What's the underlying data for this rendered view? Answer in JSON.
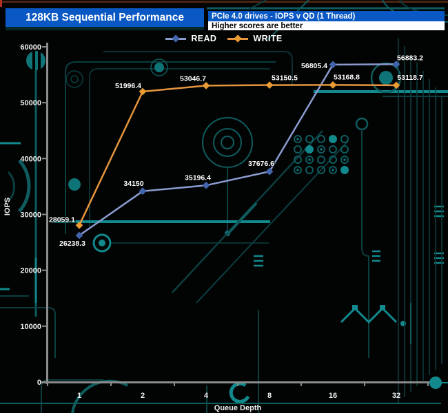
{
  "header": {
    "title": "128KB Sequential Performance",
    "subtitle": "PCIe 4.0 drives - IOPS v QD (1 Thread)",
    "note": "Higher scores are better"
  },
  "colors": {
    "title_bg": "#0a58c4",
    "subtitle_bg": "#0a58c4",
    "read_line": "#8b9cd1",
    "read_marker": "#4365ad",
    "write_line": "#e6953e",
    "write_marker": "#ea9b33",
    "axis": "#8c8c8c",
    "circuit_dim": "#0c3e40",
    "circuit_mid": "#0f5c5e",
    "circuit_bright": "#12898d",
    "circuit_fill": "#0e7478",
    "top_line": "#4a2410",
    "top_tick_red": "#b03224"
  },
  "chart_data": {
    "type": "line",
    "title": "128KB Sequential Performance",
    "subtitle": "PCIe 4.0 drives - IOPS v QD (1 Thread)",
    "note": "Higher scores are better",
    "x_categories": [
      "1",
      "2",
      "4",
      "8",
      "16",
      "32"
    ],
    "xlabel": "Queue Depth",
    "ylabel": "IOPS",
    "ylim": [
      0,
      60000
    ],
    "ytick_step": 10000,
    "ytick_labels": [
      "0",
      "10000",
      "20000",
      "30000",
      "40000",
      "50000",
      "60000"
    ],
    "grid": false,
    "legend_position": "top",
    "series": [
      {
        "name": "READ",
        "values": [
          26238.3,
          34150,
          35196.4,
          37676.6,
          56805.4,
          56883.2
        ],
        "labels": [
          "26238.3",
          "34150",
          "35196.4",
          "37676.6",
          "56805.4",
          "56883.2"
        ]
      },
      {
        "name": "WRITE",
        "values": [
          28059.1,
          51996.4,
          53046.7,
          53150.5,
          53168.8,
          53118.7
        ],
        "labels": [
          "28059.1",
          "51996.4",
          "53046.7",
          "53150.5",
          "53168.8",
          "53118.7"
        ]
      }
    ]
  }
}
